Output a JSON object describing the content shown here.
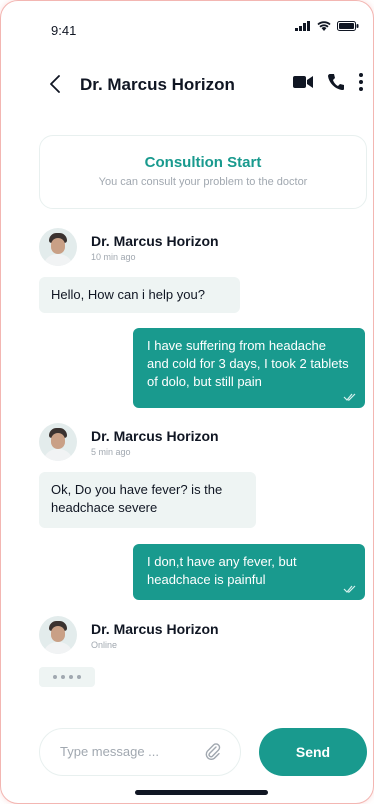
{
  "status_bar": {
    "time": "9:41"
  },
  "header": {
    "title": "Dr. Marcus Horizon"
  },
  "consult": {
    "title": "Consultion Start",
    "subtitle": "You can consult your problem to the doctor"
  },
  "messages": [
    {
      "sender": "Dr. Marcus Horizon",
      "meta": "10 min ago",
      "text": "Hello, How can i help you?"
    },
    {
      "text": "I have suffering from headache and cold for 3 days, I took 2 tablets of dolo, but still pain"
    },
    {
      "sender": "Dr. Marcus Horizon",
      "meta": "5 min ago",
      "text": "Ok, Do you have fever? is the headchace severe"
    },
    {
      "text": "I don,t have any fever, but headchace is painful"
    },
    {
      "sender": "Dr. Marcus Horizon",
      "meta": "Online"
    }
  ],
  "composer": {
    "placeholder": "Type message ...",
    "send_label": "Send"
  },
  "colors": {
    "accent": "#199a8e",
    "incoming_bubble": "#eef4f3",
    "text": "#101623",
    "muted": "#a1a8b0"
  },
  "icons": [
    "signal-icon",
    "wifi-icon",
    "battery-icon",
    "back-icon",
    "video-call-icon",
    "phone-icon",
    "more-icon",
    "double-check-icon",
    "paperclip-icon"
  ]
}
